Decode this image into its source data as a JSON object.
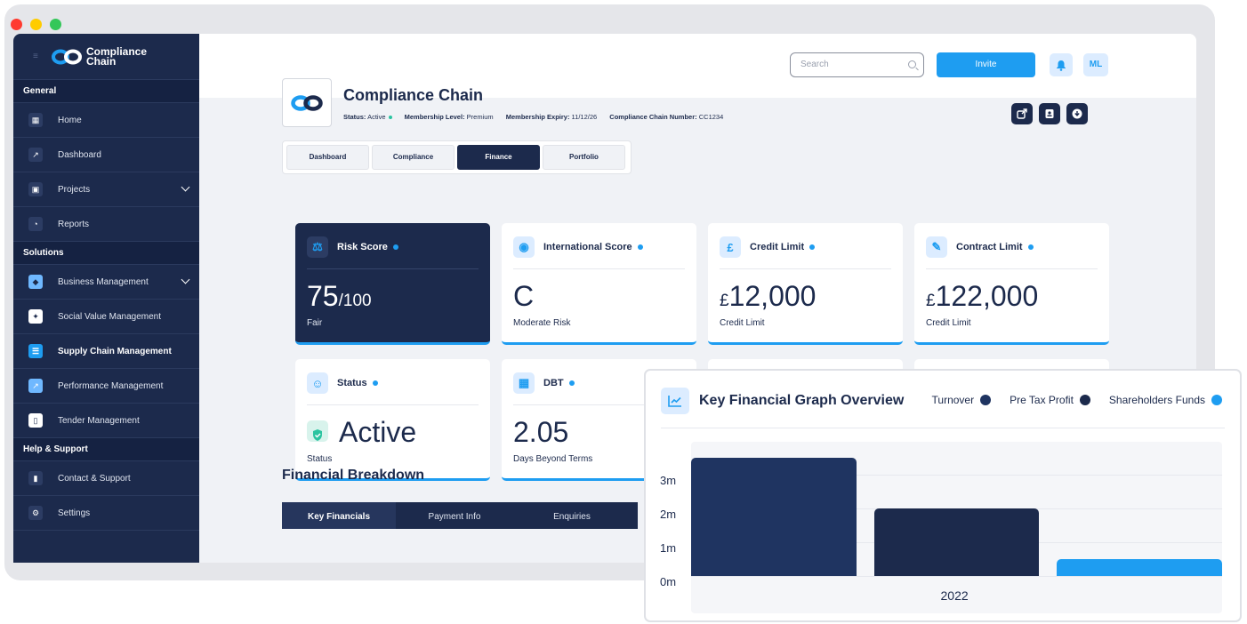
{
  "brand": {
    "name_line1": "Compliance",
    "name_line2": "Chain"
  },
  "sidebar": {
    "sections": [
      {
        "title": "General",
        "items": [
          {
            "label": "Home",
            "icon": "grid-icon"
          },
          {
            "label": "Dashboard",
            "icon": "chart-icon"
          },
          {
            "label": "Projects",
            "icon": "building-icon",
            "expandable": true
          },
          {
            "label": "Reports",
            "icon": "pie-icon"
          }
        ]
      },
      {
        "title": "Solutions",
        "items": [
          {
            "label": "Business Management",
            "icon": "shield-icon",
            "expandable": true
          },
          {
            "label": "Social Value Management",
            "icon": "handshake-icon"
          },
          {
            "label": "Supply Chain Management",
            "icon": "list-icon",
            "active": true
          },
          {
            "label": "Performance Management",
            "icon": "trend-icon"
          },
          {
            "label": "Tender Management",
            "icon": "document-icon"
          }
        ]
      },
      {
        "title": "Help & Support",
        "items": [
          {
            "label": "Contact & Support",
            "icon": "chat-icon"
          },
          {
            "label": "Settings",
            "icon": "gear-icon"
          }
        ]
      }
    ]
  },
  "topbar": {
    "search_placeholder": "Search",
    "invite_label": "Invite",
    "avatar_initials": "ML"
  },
  "company": {
    "name": "Compliance Chain",
    "status_label": "Status:",
    "status_value": "Active",
    "membership_label": "Membership Level:",
    "membership_value": "Premium",
    "expiry_label": "Membership Expiry:",
    "expiry_value": "11/12/26",
    "number_label": "Compliance Chain  Number:",
    "number_value": "CC1234"
  },
  "tabs": [
    {
      "label": "Dashboard"
    },
    {
      "label": "Compliance"
    },
    {
      "label": "Finance",
      "active": true
    },
    {
      "label": "Portfolio"
    }
  ],
  "cards": {
    "risk": {
      "title": "Risk Score",
      "value": "75",
      "suffix": "/100",
      "sub": "Fair"
    },
    "international": {
      "title": "International Score",
      "value": "C",
      "sub": "Moderate Risk"
    },
    "credit": {
      "title": "Credit Limit",
      "currency": "£",
      "value": "12,000",
      "sub": "Credit Limit"
    },
    "contract": {
      "title": "Contract Limit",
      "currency": "£",
      "value": "122,000",
      "sub": "Credit Limit"
    },
    "status": {
      "title": "Status",
      "value": "Active",
      "sub": "Status"
    },
    "dbt": {
      "title": "DBT",
      "value": "2.05",
      "sub": "Days Beyond Terms"
    }
  },
  "breakdown": {
    "title": "Financial Breakdown",
    "tabs": [
      {
        "label": "Key Financials",
        "active": true
      },
      {
        "label": "Payment Info"
      },
      {
        "label": "Enquiries"
      }
    ]
  },
  "graph": {
    "title": "Key Financial Graph Overview"
  },
  "colors": {
    "navy": "#1c2a4c",
    "accent": "#1e9df1",
    "turnover": "#1f3461",
    "pretax": "#1c2a4c",
    "shareholders": "#1e9df1"
  },
  "chart_data": {
    "type": "bar",
    "categories": [
      "2022"
    ],
    "series": [
      {
        "name": "Turnover",
        "values": [
          3.5
        ]
      },
      {
        "name": "Pre Tax Profit",
        "values": [
          2.0
        ]
      },
      {
        "name": "Shareholders Funds",
        "values": [
          0.5
        ]
      }
    ],
    "yticks": [
      "0m",
      "1m",
      "2m",
      "3m"
    ],
    "ylim": [
      0,
      3.5
    ]
  }
}
